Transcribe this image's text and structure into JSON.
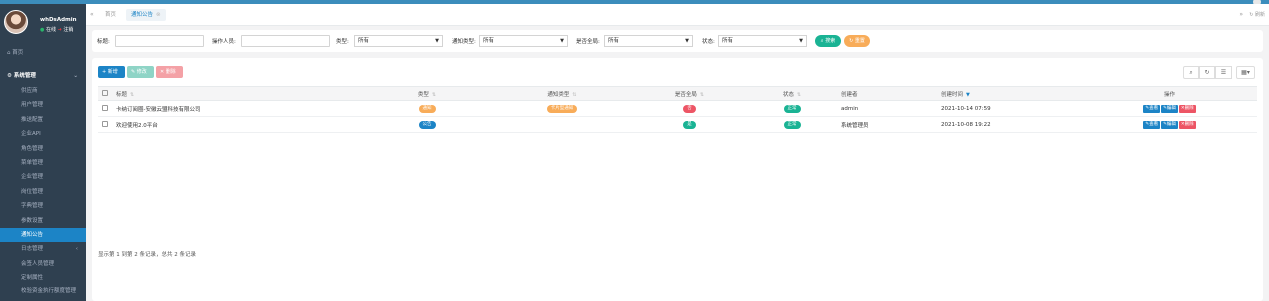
{
  "colors": {
    "sidebar_bg": "#2f4050",
    "accent": "#1c84c6",
    "success": "#1ab394",
    "warning": "#f8ac59",
    "danger": "#ed5565"
  },
  "user": {
    "name": "whDsAdmin",
    "status_online": "在线",
    "logout": "注销"
  },
  "sidebar": {
    "home": "首页",
    "system": "系统管理",
    "items": [
      {
        "label": "供应商"
      },
      {
        "label": "用户管理"
      },
      {
        "label": "推送配置"
      },
      {
        "label": "企业API"
      },
      {
        "label": "角色管理"
      },
      {
        "label": "菜单管理"
      },
      {
        "label": "企业管理"
      },
      {
        "label": "岗位管理"
      },
      {
        "label": "字典管理"
      },
      {
        "label": "参数设置"
      },
      {
        "label": "通知公告"
      },
      {
        "label": "日志管理"
      },
      {
        "label": "会签人员管理"
      },
      {
        "label": "定制属性"
      },
      {
        "label": "校验资金执行额度管理"
      }
    ]
  },
  "tabs": {
    "home": "首页",
    "active": "通知公告",
    "refresh": "刷新"
  },
  "search": {
    "title_label": "标题:",
    "operator_label": "操作人员:",
    "type_label": "类型:",
    "type_value": "所有",
    "notice_type_label": "通知类型:",
    "notice_type_value": "所有",
    "global_label": "是否全局:",
    "global_value": "所有",
    "status_label": "状态:",
    "status_value": "所有",
    "search_btn": "搜索",
    "reset_btn": "重置"
  },
  "toolbar": {
    "add": "新增",
    "edit": "修改",
    "delete": "删除"
  },
  "table": {
    "headers": {
      "title": "标题",
      "type": "类型",
      "notice_type": "通知类型",
      "global": "是否全局",
      "status": "状态",
      "creator": "创建者",
      "created": "创建时间",
      "ops": "操作"
    },
    "rows": [
      {
        "title": "卡纳订阅圈-安徽云盟科技有限公司",
        "type": "通知",
        "notice_type": "卡片型通知",
        "global": "否",
        "status": "正常",
        "creator": "admin",
        "created": "2021-10-14 07:59",
        "op_view": "查看",
        "op_edit": "编辑",
        "op_delete": "删除"
      },
      {
        "title": "欢迎使用2.0平台",
        "type": "公告",
        "notice_type": "",
        "global": "是",
        "status": "正常",
        "creator": "系统管理员",
        "created": "2021-10-08 19:22",
        "op_view": "查看",
        "op_edit": "编辑",
        "op_delete": "删除"
      }
    ]
  },
  "pagination": "显示第 1 到第 2 条记录，总共 2 条记录"
}
